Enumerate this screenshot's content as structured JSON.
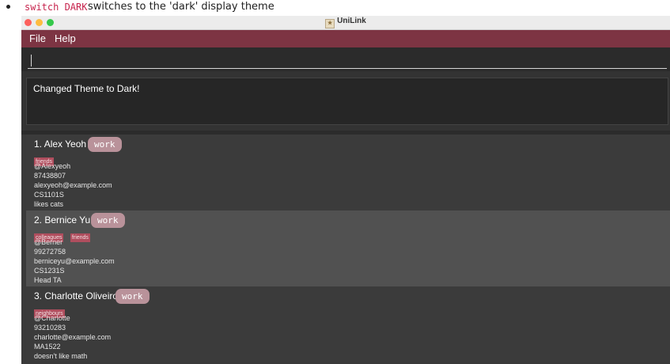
{
  "doc": {
    "code": "switch DARK",
    "text": "switches to the 'dark' display theme"
  },
  "window": {
    "title": "UniLink",
    "menu": {
      "file": "File",
      "help": "Help"
    },
    "command_input": {
      "value": "",
      "placeholder": ""
    },
    "result_message": "Changed Theme to Dark!"
  },
  "persons": [
    {
      "index": "1.",
      "name": "Alex Yeoh",
      "role": "work",
      "tags": [
        "friends"
      ],
      "handle": "@Alexyeoh",
      "phone": "87438807",
      "email": "alexyeoh@example.com",
      "module": "CS1101S",
      "remark": "likes cats"
    },
    {
      "index": "2.",
      "name": "Bernice Yu",
      "role": "work",
      "tags": [
        "colleagues",
        "friends"
      ],
      "handle": "@Berner",
      "phone": "99272758",
      "email": "berniceyu@example.com",
      "module": "CS1231S",
      "remark": "Head TA"
    },
    {
      "index": "3.",
      "name": "Charlotte Oliveiro",
      "role": "work",
      "tags": [
        "neighbours"
      ],
      "handle": "@Charlotte",
      "phone": "93210283",
      "email": "charlotte@example.com",
      "module": "MA1522",
      "remark": "doesn't like math"
    }
  ],
  "colors": {
    "menubar": "#7d3443",
    "tag": "#b04e5e",
    "role_badge": "#b9929a",
    "code_text": "#c7254e"
  }
}
